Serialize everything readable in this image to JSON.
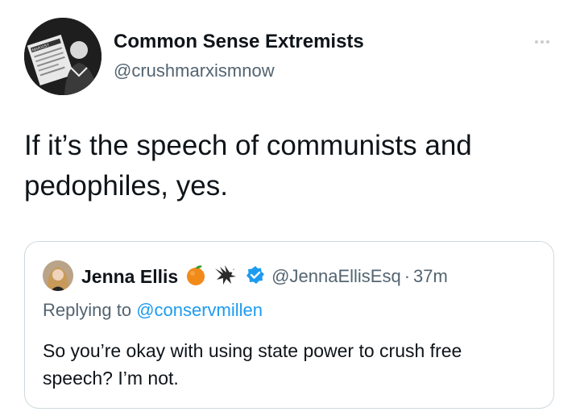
{
  "tweet": {
    "author_name": "Common Sense Extremists",
    "author_handle": "@crushmarxismnow",
    "text": "If it’s the speech of communists and pedophiles, yes.",
    "more_icon": "more-horizontal-icon",
    "avatar_newspaper_text": "MARXIST"
  },
  "quoted": {
    "author_name": "Jenna Ellis",
    "author_handle": "@JennaEllisEsq",
    "separator": "·",
    "time": "37m",
    "replying_prefix": "Replying to",
    "replying_handle": "@conservmillen",
    "text": "So you’re okay with using state power to crush free speech? I’m not.",
    "badges": [
      "orange-icon",
      "eagle-icon",
      "verified-badge-icon"
    ]
  },
  "colors": {
    "text_primary": "#0f1419",
    "text_secondary": "#536471",
    "link": "#1d9bf0",
    "border": "#cfd9de"
  }
}
